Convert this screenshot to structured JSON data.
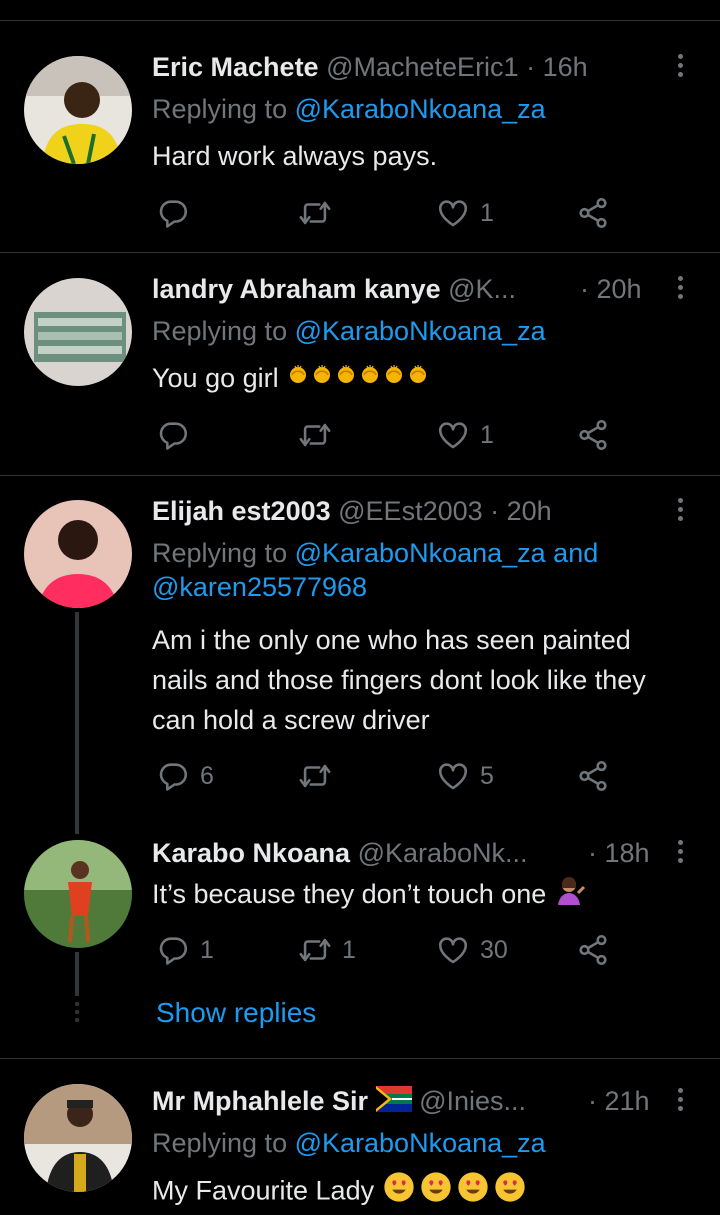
{
  "tweets": [
    {
      "name": "Eric Machete",
      "handle": "@MacheteEric1",
      "time": "· 16h",
      "replying_label": "Replying to ",
      "replying_to": "@KaraboNkoana_za",
      "text": "Hard work always pays.",
      "replies": "",
      "retweets": "",
      "likes": "1"
    },
    {
      "name": "landry Abraham kanye",
      "handle": "@K...",
      "time": "· 20h",
      "replying_label": "Replying to ",
      "replying_to": "@KaraboNkoana_za",
      "text": "You go girl",
      "replies": "",
      "retweets": "",
      "likes": "1"
    },
    {
      "name": "Elijah est2003",
      "handle": "@EEst2003",
      "time": "· 20h",
      "replying_label": "Replying to ",
      "replying_to": "@KaraboNkoana_za",
      "replying_and": " and",
      "replying_to_2": "@karen25577968",
      "text": "Am i the only one who has seen painted nails and those fingers dont look like they can hold a screw driver",
      "replies": "6",
      "retweets": "",
      "likes": "5"
    },
    {
      "name": "Karabo Nkoana",
      "handle": "@KaraboNk...",
      "time": "· 18h",
      "text": "It’s because they don’t touch one",
      "replies": "1",
      "retweets": "1",
      "likes": "30"
    },
    {
      "name": "Mr Mphahlele Sir",
      "handle": "@Inies...",
      "time": "· 21h",
      "replying_label": "Replying to ",
      "replying_to": "@KaraboNkoana_za",
      "text": "My Favourite Lady"
    }
  ],
  "show_replies": "Show replies",
  "colors": {
    "background": "#000000",
    "text": "#e7e9ea",
    "secondary": "#71767b",
    "link": "#1d9bf0",
    "divider": "#2f3336"
  },
  "icons": [
    "reply-icon",
    "retweet-icon",
    "like-icon",
    "share-icon",
    "more-icon",
    "raising-hands-emoji",
    "tipping-hand-emoji",
    "heart-eyes-emoji",
    "south-africa-flag"
  ]
}
